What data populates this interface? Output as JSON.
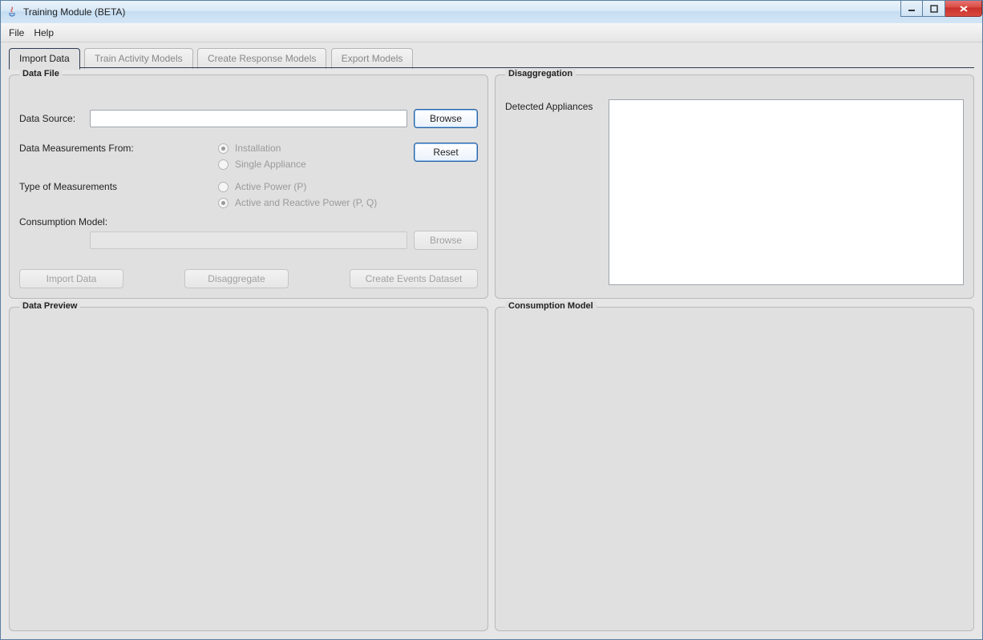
{
  "window": {
    "title": "Training Module (BETA)"
  },
  "menu": {
    "file": "File",
    "help": "Help"
  },
  "tabs": {
    "import_data": "Import Data",
    "train_activity": "Train Activity Models",
    "create_response": "Create Response Models",
    "export_models": "Export Models"
  },
  "data_file": {
    "legend": "Data File",
    "data_source_label": "Data Source:",
    "data_source_value": "",
    "browse": "Browse",
    "reset": "Reset",
    "measurements_from_label": "Data Measurements From:",
    "radio_installation": "Installation",
    "radio_single_appliance": "Single Appliance",
    "type_label": "Type of Measurements",
    "radio_active_p": "Active Power (P)",
    "radio_active_reactive": "Active and Reactive Power (P, Q)",
    "consumption_model_label": "Consumption Model:",
    "consumption_model_value": "",
    "browse2": "Browse",
    "btn_import": "Import Data",
    "btn_disaggregate": "Disaggregate",
    "btn_create_events": "Create Events Dataset"
  },
  "disaggregation": {
    "legend": "Disaggregation",
    "detected_label": "Detected Appliances"
  },
  "data_preview": {
    "legend": "Data Preview"
  },
  "consumption_model_panel": {
    "legend": "Consumption Model"
  }
}
